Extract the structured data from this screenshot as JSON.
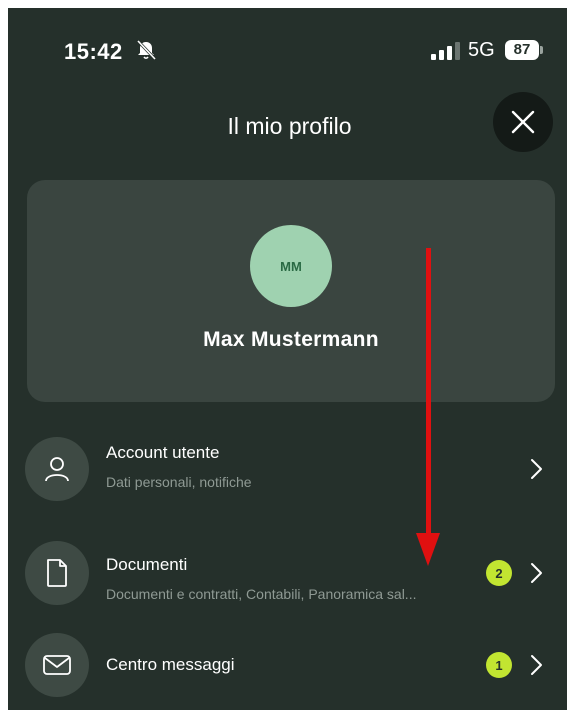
{
  "status_bar": {
    "time": "15:42",
    "network": "5G",
    "battery": "87"
  },
  "header": {
    "title": "Il mio profilo"
  },
  "profile": {
    "initials": "MM",
    "name": "Max Mustermann"
  },
  "menu": [
    {
      "title": "Account utente",
      "subtitle": "Dati personali, notifiche",
      "icon": "user-icon"
    },
    {
      "title": "Documenti",
      "subtitle": "Documenti e contratti, Contabili, Panoramica sal...",
      "icon": "document-icon",
      "badge": "2"
    },
    {
      "title": "Centro messaggi",
      "icon": "mail-icon",
      "badge": "1"
    }
  ],
  "colors": {
    "background": "#25302b",
    "card": "#3a4540",
    "avatar": "#9fd2b0",
    "badge": "#c2e531",
    "arrow": "#e01010"
  }
}
